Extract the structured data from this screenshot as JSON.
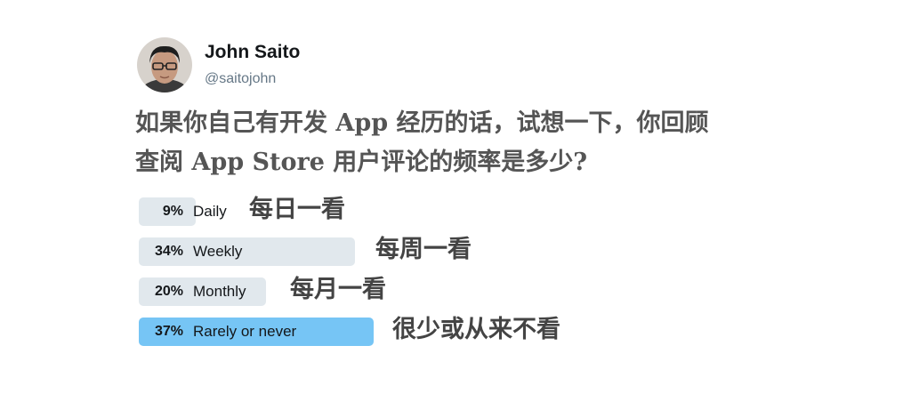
{
  "tweet": {
    "author_name": "John Saito",
    "author_handle": "@saitojohn",
    "question_lines": [
      "如果你自己有开发 App 经历的话，试想一下，你回顾",
      "查阅 App Store 用户评论的频率是多少?"
    ]
  },
  "poll": {
    "options": [
      {
        "percent_label": "9%",
        "percent": 9,
        "label": "Daily",
        "translation": "每日一看",
        "leading": false
      },
      {
        "percent_label": "34%",
        "percent": 34,
        "label": "Weekly",
        "translation": "每周一看",
        "leading": false
      },
      {
        "percent_label": "20%",
        "percent": 20,
        "label": "Monthly",
        "translation": "每月一看",
        "leading": false
      },
      {
        "percent_label": "37%",
        "percent": 37,
        "label": "Rarely or never",
        "translation": "很少或从来不看",
        "leading": true
      }
    ]
  },
  "colors": {
    "bar_default": "#e1e8ed",
    "bar_leading": "#76c5f5",
    "handle_text": "#657786"
  }
}
